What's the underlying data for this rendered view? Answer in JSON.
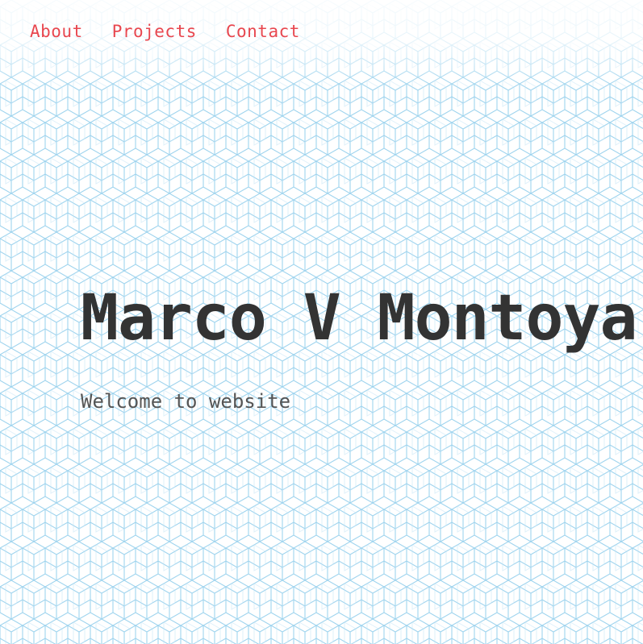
{
  "nav": {
    "items": [
      {
        "label": "About"
      },
      {
        "label": "Projects"
      },
      {
        "label": "Contact"
      }
    ]
  },
  "hero": {
    "title": "Marco V Montoya",
    "subtitle": "Welcome to website"
  },
  "colors": {
    "nav_link": "#e8474f",
    "title": "#333333",
    "subtitle": "#555555",
    "pattern_stroke": "#9fd4ee",
    "background": "#ffffff"
  },
  "background_pattern": "hexagonal-cube-outline"
}
